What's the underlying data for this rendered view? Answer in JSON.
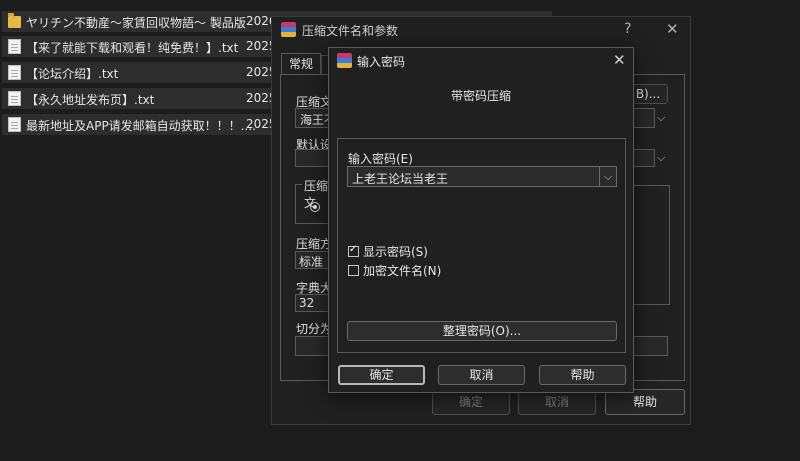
{
  "files": [
    {
      "icon": "folder-icon",
      "name": "ヤリチン不動産～家賃回収物語～ 製品版",
      "date": "2026"
    },
    {
      "icon": "document-icon",
      "name": "【来了就能下载和观看！纯免费！】.txt",
      "date": "2025"
    },
    {
      "icon": "document-icon",
      "name": "【论坛介绍】.txt",
      "date": "2025"
    },
    {
      "icon": "document-icon",
      "name": "【永久地址发布页】.txt",
      "date": "2025"
    },
    {
      "icon": "document-icon",
      "name": "最新地址及APP请发邮箱自动获取！！！....",
      "date": "2025"
    }
  ],
  "back_dialog": {
    "title": "压缩文件名和参数",
    "help": "?",
    "close": "✕",
    "tab": "常规",
    "archive_name_label": "压缩文",
    "archive_name_value": "海王不",
    "browse_label": "B)...",
    "default_settings_label": "默认设",
    "format_group_label": "压缩文",
    "method_label": "压缩方",
    "method_value": "标准",
    "dict_label": "字典大",
    "dict_value": "32",
    "split_label": "切分为",
    "ok": "确定",
    "cancel": "取消",
    "help_button": "帮助"
  },
  "dialog": {
    "title": "输入密码",
    "heading": "带密码压缩",
    "password_label": "输入密码(E)",
    "password_value": "上老王论坛当老王",
    "show_password": "显示密码(S)",
    "show_password_checked": true,
    "encrypt_names": "加密文件名(N)",
    "encrypt_names_checked": false,
    "organize": "整理密码(O)...",
    "ok": "确定",
    "cancel": "取消",
    "help": "帮助"
  }
}
